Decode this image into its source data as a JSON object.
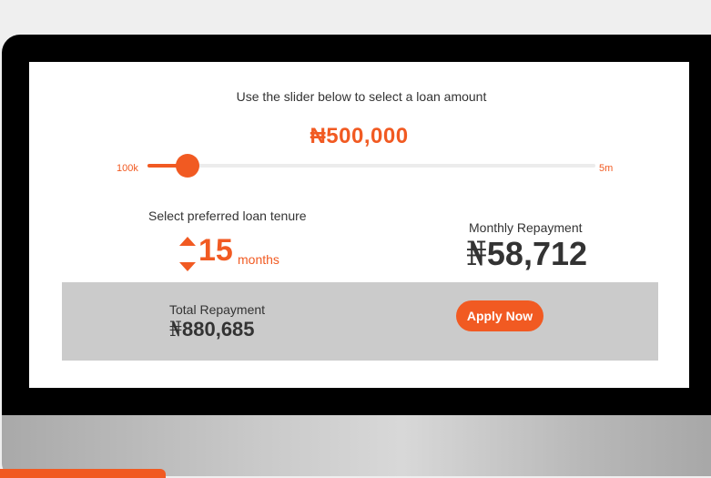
{
  "calculator": {
    "instruction": "Use the slider below to select a loan amount",
    "loan_amount": "₦500,000",
    "slider": {
      "min_label": "100k",
      "max_label": "5m",
      "level": 0.09
    },
    "tenure": {
      "label": "Select preferred loan tenure",
      "value": "15",
      "unit": "months"
    },
    "monthly": {
      "label": "Monthly Repayment",
      "currency": "₦",
      "amount": "58,712"
    },
    "total": {
      "label": "Total Repayment",
      "currency": "₦",
      "amount": "880,685"
    },
    "apply_label": "Apply Now"
  },
  "colors": {
    "accent": "#f15a22",
    "text": "#333333",
    "panel": "#cbcbcb",
    "bezel": "#000000"
  },
  "icons": {
    "increase": "triangle-up-icon",
    "decrease": "triangle-down-icon"
  }
}
